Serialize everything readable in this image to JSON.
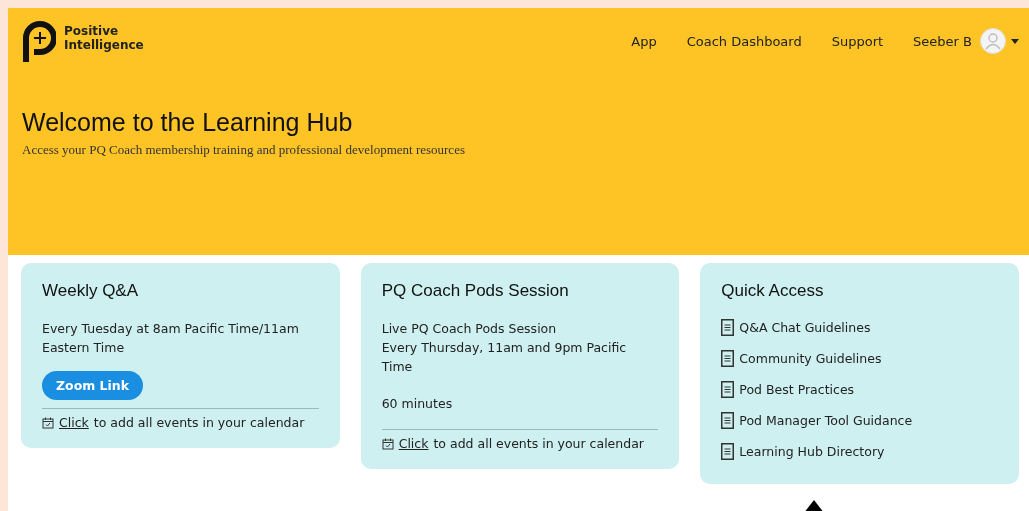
{
  "brand": {
    "line1": "Positive",
    "line2": "Intelligence"
  },
  "nav": [
    "App",
    "Coach Dashboard",
    "Support"
  ],
  "user": {
    "name": "Seeber B"
  },
  "hero": {
    "title": "Welcome to the Learning Hub",
    "subtitle": "Access your PQ Coach membership training and professional development resources"
  },
  "cards": [
    {
      "kind": "event",
      "title": "Weekly Q&A",
      "lines": [
        "Every Tuesday at 8am Pacific Time/11am Eastern Time"
      ],
      "button": "Zoom Link",
      "calendar": {
        "link": "Click",
        "text": "to add all events in your calendar"
      }
    },
    {
      "kind": "event",
      "title": "PQ Coach Pods Session",
      "lines": [
        "Live PQ Coach Pods Session",
        "Every Thursday, 11am and 9pm Pacific Time",
        "60 minutes"
      ],
      "calendar": {
        "link": "Click",
        "text": "to add all events in your calendar"
      }
    },
    {
      "kind": "links",
      "title": "Quick Access",
      "links": [
        "Q&A Chat Guidelines",
        "Community Guidelines",
        "Pod Best Practices",
        "Pod Manager Tool Guidance",
        "Learning Hub Directory"
      ]
    }
  ]
}
